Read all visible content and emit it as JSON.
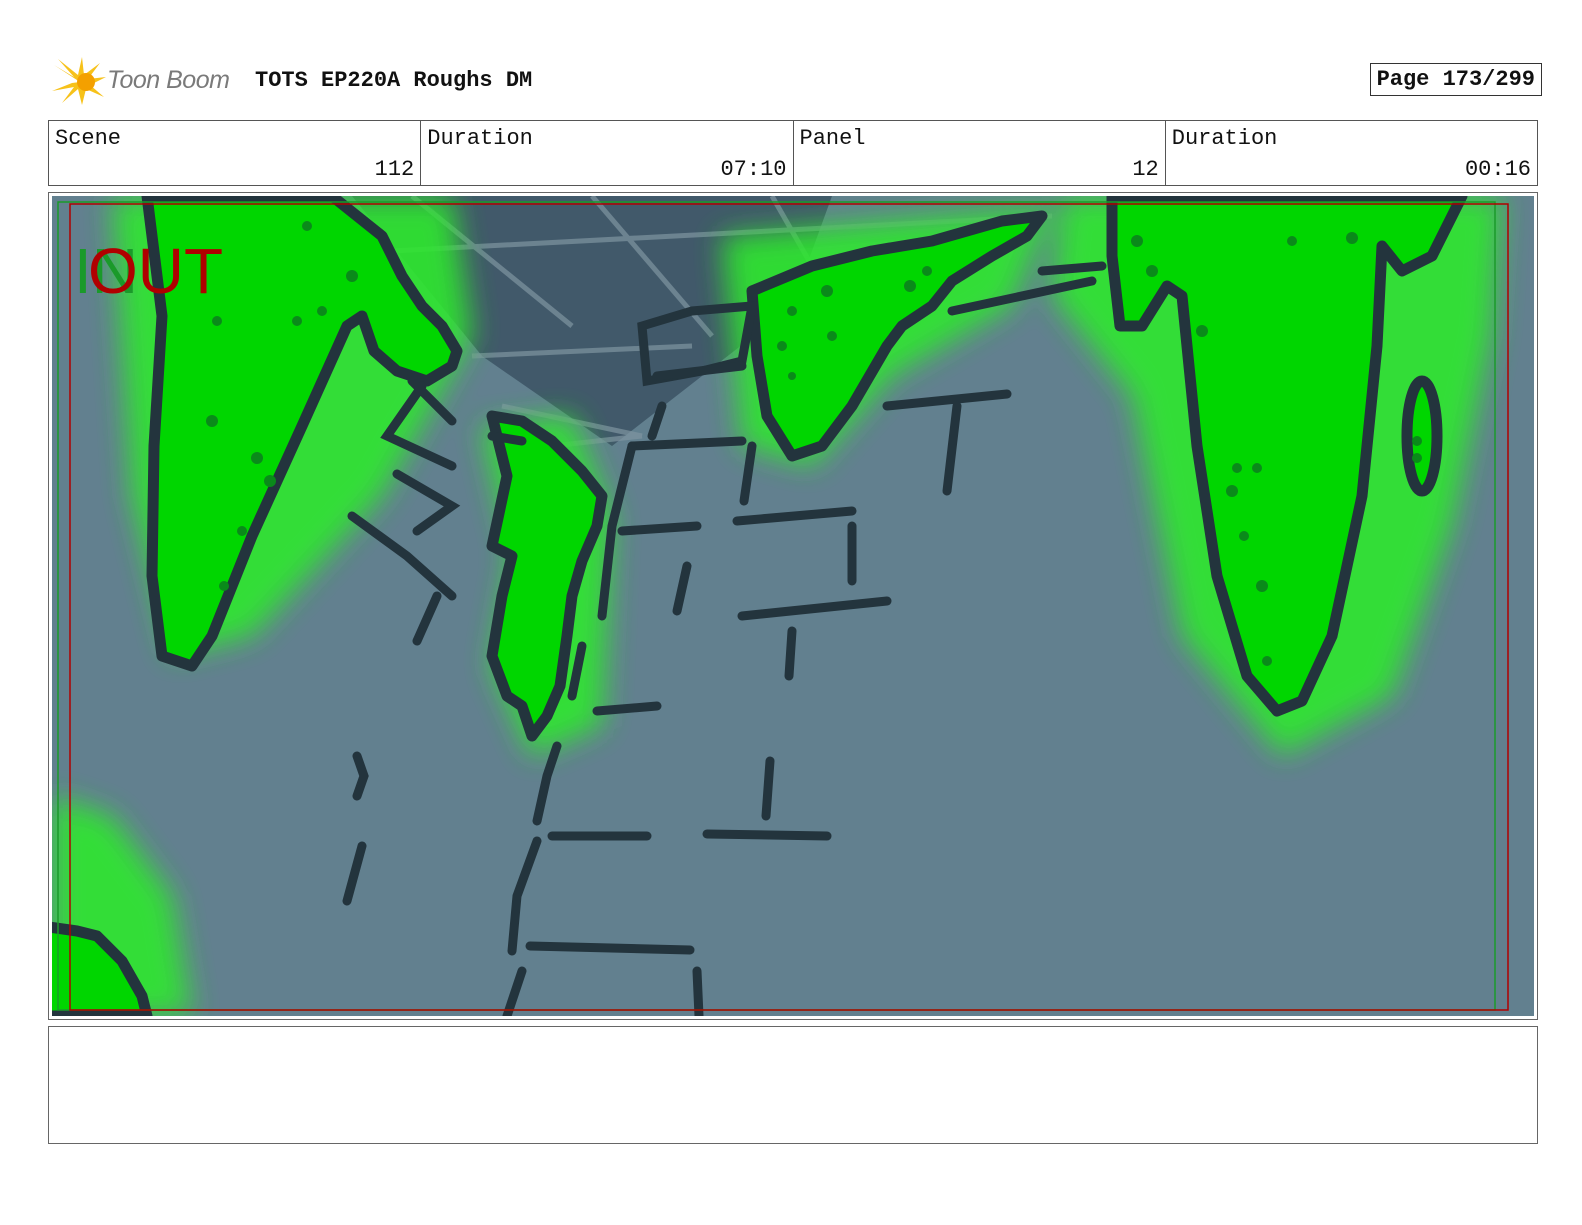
{
  "header": {
    "logo_text": "Toon Boom",
    "title": "TOTS EP220A Roughs DM",
    "page": "Page 173/299"
  },
  "info": {
    "scene_label": "Scene",
    "scene_value": "112",
    "scene_duration_label": "Duration",
    "scene_duration_value": "07:10",
    "panel_label": "Panel",
    "panel_value": "12",
    "panel_duration_label": "Duration",
    "panel_duration_value": "00:16"
  },
  "panel": {
    "in_label": "IN",
    "out_label": "OUT",
    "colors": {
      "background": "#62808f",
      "ceiling": "#41596a",
      "slime": "#00d600",
      "slime_glow": "#2de82d",
      "ink": "#23343d",
      "in_marker": "#1a9a2a",
      "out_marker": "#b00000"
    }
  },
  "notes": {
    "text": ""
  }
}
